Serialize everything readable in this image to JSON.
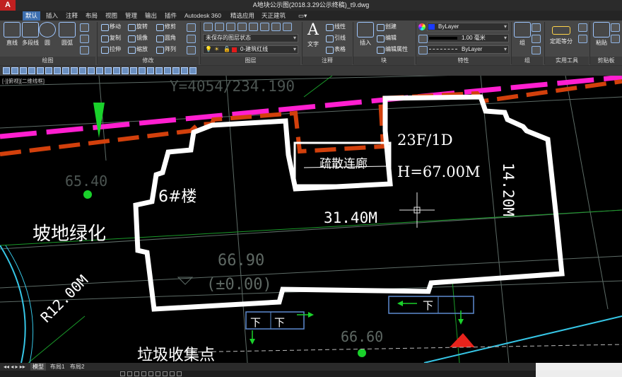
{
  "app": {
    "logo_letter": "A",
    "window_title": "A地块公示图(2018.3.29公示终稿)_t9.dwg"
  },
  "tabs": [
    "默认",
    "插入",
    "注释",
    "布局",
    "视图",
    "管理",
    "输出",
    "插件",
    "Autodesk 360",
    "精选应用",
    "天正建筑"
  ],
  "ribbon": {
    "draw": {
      "buttons": [
        "直线",
        "多段线",
        "圆",
        "圆弧"
      ],
      "title": "绘图"
    },
    "modify": {
      "buttons": [
        "移动",
        "旋转",
        "修剪",
        "复制",
        "镜像",
        "圆角",
        "拉伸",
        "缩放",
        "阵列"
      ],
      "title": "修改"
    },
    "layers": {
      "layer_state": "未保存的图层状态",
      "current_layer": "0-建筑红线",
      "title": "图层"
    },
    "annotation": {
      "text_button": "文字",
      "buttons": [
        "线性",
        "引线",
        "表格"
      ],
      "title": "注释"
    },
    "block": {
      "insert_button": "插入",
      "buttons": [
        "创建",
        "编辑",
        "编辑属性"
      ],
      "title": "块"
    },
    "properties": {
      "color": "ByLayer",
      "lineweight": "1.00 毫米",
      "linetype": "ByLayer",
      "title": "特性"
    },
    "groups": {
      "button": "组",
      "title": "组"
    },
    "utilities": {
      "button": "定距等分",
      "title": "实用工具"
    },
    "clipboard": {
      "button": "粘贴",
      "title": "剪贴板"
    }
  },
  "canvas": {
    "viewport_label": "[-][俯视][二维线框]",
    "coord_text": "Y=4054/234.190",
    "elevation_left": "65.40",
    "slope_green": "坡地绿化",
    "building_name": "6#楼",
    "corridor": "疏散连廊",
    "floors": "23F/1D",
    "height": "H=67.00M",
    "width_dim": "31.40M",
    "depth_dim": "14.20M",
    "elevation_center": "66.90",
    "zero_level": "(±0.00)",
    "radius": "R12.00M",
    "down1": "下",
    "down2": "下",
    "down3": "下",
    "elevation_bottom": "66.60",
    "garbage": "垃圾收集点"
  },
  "layout_tabs": [
    "模型",
    "布局1",
    "布局2"
  ],
  "colors": {
    "magenta_line": "#ff1fd0",
    "orange_line": "#d2400c",
    "white_line": "#ffffff",
    "green_mark": "#1ad12b",
    "red_mark": "#e8231c"
  }
}
